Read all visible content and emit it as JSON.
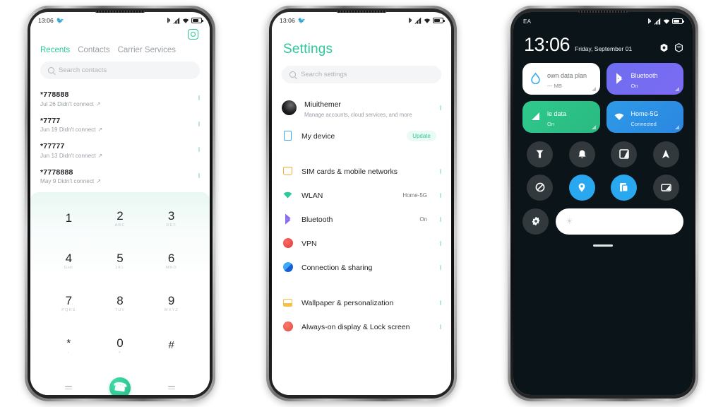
{
  "statusbar": {
    "time": "13:06",
    "icons": [
      "bluetooth-icon",
      "signal-icon",
      "wifi-icon",
      "battery-icon"
    ],
    "notification_icon": "bird-icon"
  },
  "dialer": {
    "settings_icon": "gear-icon",
    "tabs": [
      {
        "label": "Recents",
        "active": true
      },
      {
        "label": "Contacts",
        "active": false
      },
      {
        "label": "Carrier Services",
        "active": false
      }
    ],
    "search": {
      "placeholder": "Search contacts",
      "icon": "search-icon"
    },
    "call_log": [
      {
        "number": "*778888",
        "detail": "Jul 26 Didn't connect"
      },
      {
        "number": "*7777",
        "detail": "Jun 19 Didn't connect"
      },
      {
        "number": "*77777",
        "detail": "Jun 13 Didn't connect"
      },
      {
        "number": "*7778888",
        "detail": "May 9 Didn't connect"
      }
    ],
    "keypad": [
      {
        "digit": "1",
        "letters": ""
      },
      {
        "digit": "2",
        "letters": "ABC"
      },
      {
        "digit": "3",
        "letters": "DEF"
      },
      {
        "digit": "4",
        "letters": "GHI"
      },
      {
        "digit": "5",
        "letters": "JKL"
      },
      {
        "digit": "6",
        "letters": "MNO"
      },
      {
        "digit": "7",
        "letters": "PQRS"
      },
      {
        "digit": "8",
        "letters": "TUV"
      },
      {
        "digit": "9",
        "letters": "WXYZ"
      },
      {
        "digit": "*",
        "letters": ","
      },
      {
        "digit": "0",
        "letters": "+"
      },
      {
        "digit": "#",
        "letters": ""
      }
    ],
    "call_button": "call-button",
    "accent_color": "#2ec89b"
  },
  "settings": {
    "title": "Settings",
    "search": {
      "placeholder": "Search settings",
      "icon": "search-icon"
    },
    "items": [
      {
        "title": "Miuithemer",
        "subtitle": "Manage accounts, cloud services, and more",
        "value": "",
        "badge": "",
        "icon": "account-avatar"
      },
      {
        "title": "My device",
        "subtitle": "",
        "value": "",
        "badge": "Update",
        "icon": "device-icon"
      },
      {
        "title": "SIM cards & mobile networks",
        "subtitle": "",
        "value": "",
        "badge": "",
        "icon": "sim-icon"
      },
      {
        "title": "WLAN",
        "subtitle": "",
        "value": "Home-5G",
        "badge": "",
        "icon": "wifi-icon"
      },
      {
        "title": "Bluetooth",
        "subtitle": "",
        "value": "On",
        "badge": "",
        "icon": "bluetooth-icon"
      },
      {
        "title": "VPN",
        "subtitle": "",
        "value": "",
        "badge": "",
        "icon": "vpn-icon"
      },
      {
        "title": "Connection & sharing",
        "subtitle": "",
        "value": "",
        "badge": "",
        "icon": "connection-icon"
      },
      {
        "title": "Wallpaper & personalization",
        "subtitle": "",
        "value": "",
        "badge": "",
        "icon": "wallpaper-icon"
      },
      {
        "title": "Always-on display & Lock screen",
        "subtitle": "",
        "value": "",
        "badge": "",
        "icon": "lock-icon"
      }
    ],
    "title_color": "#2ec89b"
  },
  "control_center": {
    "carrier": "EA",
    "clock": "13:06",
    "date": "Friday, September 01",
    "header_icons": [
      "settings-hex-icon",
      "power-hex-icon"
    ],
    "tiles": [
      {
        "title": "own data plan",
        "subtitle": "--- MB",
        "icon": "data-drop-icon",
        "state": "off"
      },
      {
        "title": "Bluetooth",
        "subtitle": "On",
        "icon": "bluetooth-icon",
        "state": "on"
      },
      {
        "title": "le data",
        "subtitle": "On",
        "icon": "mobile-data-icon",
        "state": "on"
      },
      {
        "title": "Home-5G",
        "subtitle": "Connected",
        "icon": "wifi-icon",
        "state": "on"
      }
    ],
    "toggles": [
      {
        "icon": "flashlight-icon",
        "state": "off"
      },
      {
        "icon": "silent-bell-icon",
        "state": "off"
      },
      {
        "icon": "dark-mode-icon",
        "state": "off"
      },
      {
        "icon": "navigation-icon",
        "state": "off"
      },
      {
        "icon": "dnd-icon",
        "state": "off"
      },
      {
        "icon": "location-icon",
        "state": "on"
      },
      {
        "icon": "screenshot-icon",
        "state": "on"
      },
      {
        "icon": "cast-icon",
        "state": "off"
      },
      {
        "icon": "sync-icon",
        "state": "off"
      }
    ],
    "brightness": {
      "icon": "brightness-sun-icon",
      "level": 100
    },
    "drag_handle": "drag-handle",
    "accent_on_color": "#2aa8ef"
  }
}
